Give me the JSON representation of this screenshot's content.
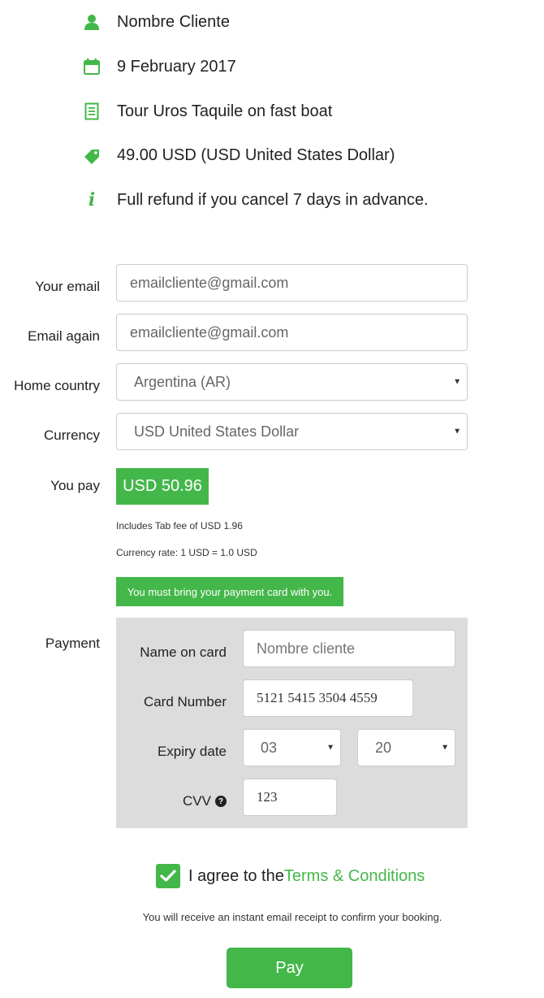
{
  "summary": {
    "customer_name": "Nombre Cliente",
    "date": "9 February 2017",
    "tour": "Tour Uros Taquile on fast boat",
    "price": "49.00 USD (USD United States Dollar)",
    "refund_policy": "Full refund if you cancel 7 days in advance.",
    "icons": [
      "user-icon",
      "calendar-icon",
      "document-icon",
      "price-tag-icon",
      "info-icon"
    ]
  },
  "form": {
    "email_label": "Your email",
    "email_value": "emailcliente@gmail.com",
    "email_again_label": "Email again",
    "email_again_value": "emailcliente@gmail.com",
    "country_label": "Home country",
    "country_value": "Argentina (AR)",
    "currency_label": "Currency",
    "currency_value": "USD United States Dollar",
    "you_pay_label": "You pay",
    "you_pay_amount": "USD 50.96",
    "fee_note": "Includes Tab fee of USD 1.96",
    "rate_note": "Currency rate: 1 USD = 1.0 USD",
    "card_notice": "You must bring your payment card with you."
  },
  "payment": {
    "label": "Payment",
    "name_label": "Name on card",
    "name_placeholder": "Nombre cliente",
    "card_number_label": "Card Number",
    "card_number_value": "5121 5415 3504 4559",
    "expiry_label": "Expiry date",
    "expiry_month": "03",
    "expiry_year": "20",
    "cvv_label": "CVV",
    "cvv_value": "123"
  },
  "agreement": {
    "checked": true,
    "text": "I agree to the ",
    "link": "Terms & Conditions",
    "receipt_note": "You will receive an instant email receipt to confirm your booking."
  },
  "pay_button": "Pay",
  "colors": {
    "accent": "#44b74a",
    "panel": "#dcdcdc"
  }
}
